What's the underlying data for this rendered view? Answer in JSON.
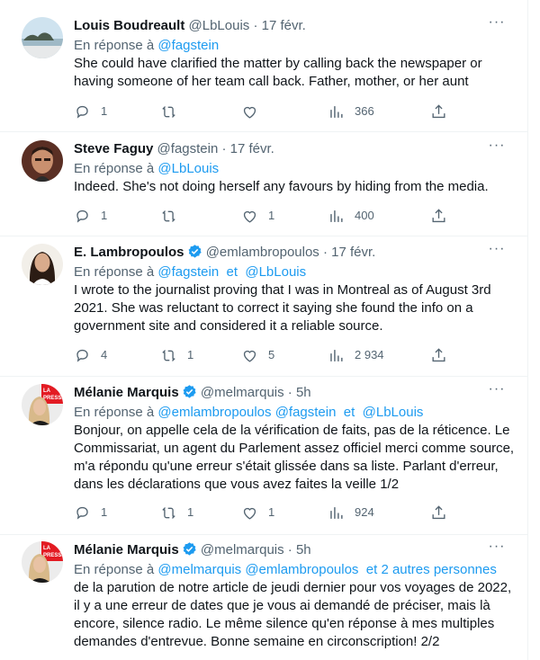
{
  "tweets": [
    {
      "author": "Louis Boudreault",
      "handle": "@LbLouis",
      "sep": "·",
      "time": "17 févr.",
      "reply_prefix": "En réponse à",
      "reply_to": "@fagstein",
      "text": "She could have clarified the matter by calling back the newspaper or having someone of her team call back. Father, mother, or her aunt",
      "replies": "1",
      "retweets": "",
      "likes": "",
      "views": "366"
    },
    {
      "author": "Steve Faguy",
      "handle": "@fagstein",
      "sep": "·",
      "time": "17 févr.",
      "reply_prefix": "En réponse à",
      "reply_to": "@LbLouis",
      "text": "Indeed. She's not doing herself any favours by hiding from the media.",
      "replies": "1",
      "retweets": "",
      "likes": "1",
      "views": "400"
    },
    {
      "author": "E. Lambropoulos",
      "handle": "@emlambropoulos",
      "sep": "·",
      "time": "17 févr.",
      "reply_prefix": "En réponse à",
      "reply_to": "@fagstein  et  @LbLouis",
      "text": "I wrote to the journalist proving that I was in Montreal as of August 3rd 2021. She was reluctant to correct it saying she found the info on a government site and considered it a reliable source.",
      "replies": "4",
      "retweets": "1",
      "likes": "5",
      "views": "2 934"
    },
    {
      "author": "Mélanie Marquis",
      "handle": "@melmarquis",
      "sep": "·",
      "time": "5h",
      "reply_prefix": "En réponse à",
      "reply_to": "@emlambropoulos @fagstein  et  @LbLouis",
      "text": "Bonjour, on appelle cela de la vérification de faits, pas de la réticence. Le Commissariat, un agent du Parlement assez officiel merci comme source, m'a répondu qu'une erreur s'était glissée dans sa liste. Parlant d'erreur, dans les déclarations que vous avez faites la veille 1/2",
      "replies": "1",
      "retweets": "1",
      "likes": "1",
      "views": "924"
    },
    {
      "author": "Mélanie Marquis",
      "handle": "@melmarquis",
      "sep": "·",
      "time": "5h",
      "reply_prefix": "En réponse à",
      "reply_to": "@melmarquis @emlambropoulos  et 2 autres personnes",
      "text": "de la parution de notre article de jeudi dernier pour vos voyages de 2022, il y a une erreur de dates que je vous ai demandé de préciser, mais là encore, silence radio. Le même silence qu'en réponse à mes multiples demandes d'entrevue. Bonne semaine en circonscription! 2/2",
      "replies": "",
      "retweets": "",
      "likes": "",
      "views": ""
    }
  ],
  "colors": {
    "link": "#1d9bf0",
    "muted": "#536471",
    "verified": "#1d9bf0",
    "text": "#0f1419"
  },
  "avatar_badge_text": "LA PRESSE"
}
